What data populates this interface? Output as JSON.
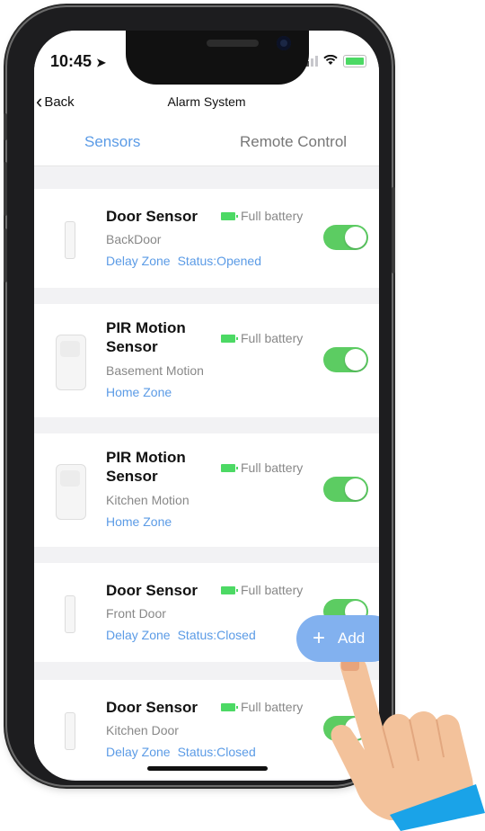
{
  "status_bar": {
    "time": "10:45"
  },
  "nav": {
    "back_label": "Back",
    "title": "Alarm System"
  },
  "tabs": [
    {
      "label": "Sensors",
      "active": true
    },
    {
      "label": "Remote Control",
      "active": false
    }
  ],
  "devices": [
    {
      "name": "Door Sensor",
      "battery": "Full battery",
      "location": "BackDoor",
      "zone": "Delay Zone",
      "status": "Status:Opened",
      "enabled": true,
      "icon": "door-sensor-icon"
    },
    {
      "name": "PIR Motion Sensor",
      "battery": "Full battery",
      "location": "Basement Motion",
      "zone": "Home Zone",
      "status": "",
      "enabled": true,
      "icon": "pir-sensor-icon"
    },
    {
      "name": "PIR Motion Sensor",
      "battery": "Full battery",
      "location": "Kitchen Motion",
      "zone": "Home Zone",
      "status": "",
      "enabled": true,
      "icon": "pir-sensor-icon"
    },
    {
      "name": "Door Sensor",
      "battery": "Full battery",
      "location": "Front Door",
      "zone": "Delay Zone",
      "status": "Status:Closed",
      "enabled": true,
      "icon": "door-sensor-icon"
    },
    {
      "name": "Door Sensor",
      "battery": "Full battery",
      "location": "Kitchen Door",
      "zone": "Delay Zone",
      "status": "Status:Closed",
      "enabled": true,
      "icon": "door-sensor-icon"
    }
  ],
  "add_button": {
    "label": "Add"
  },
  "colors": {
    "accent": "#5b9be6",
    "toggle_on": "#5ccc62",
    "battery": "#4cd964",
    "fab": "#82b1ef"
  }
}
